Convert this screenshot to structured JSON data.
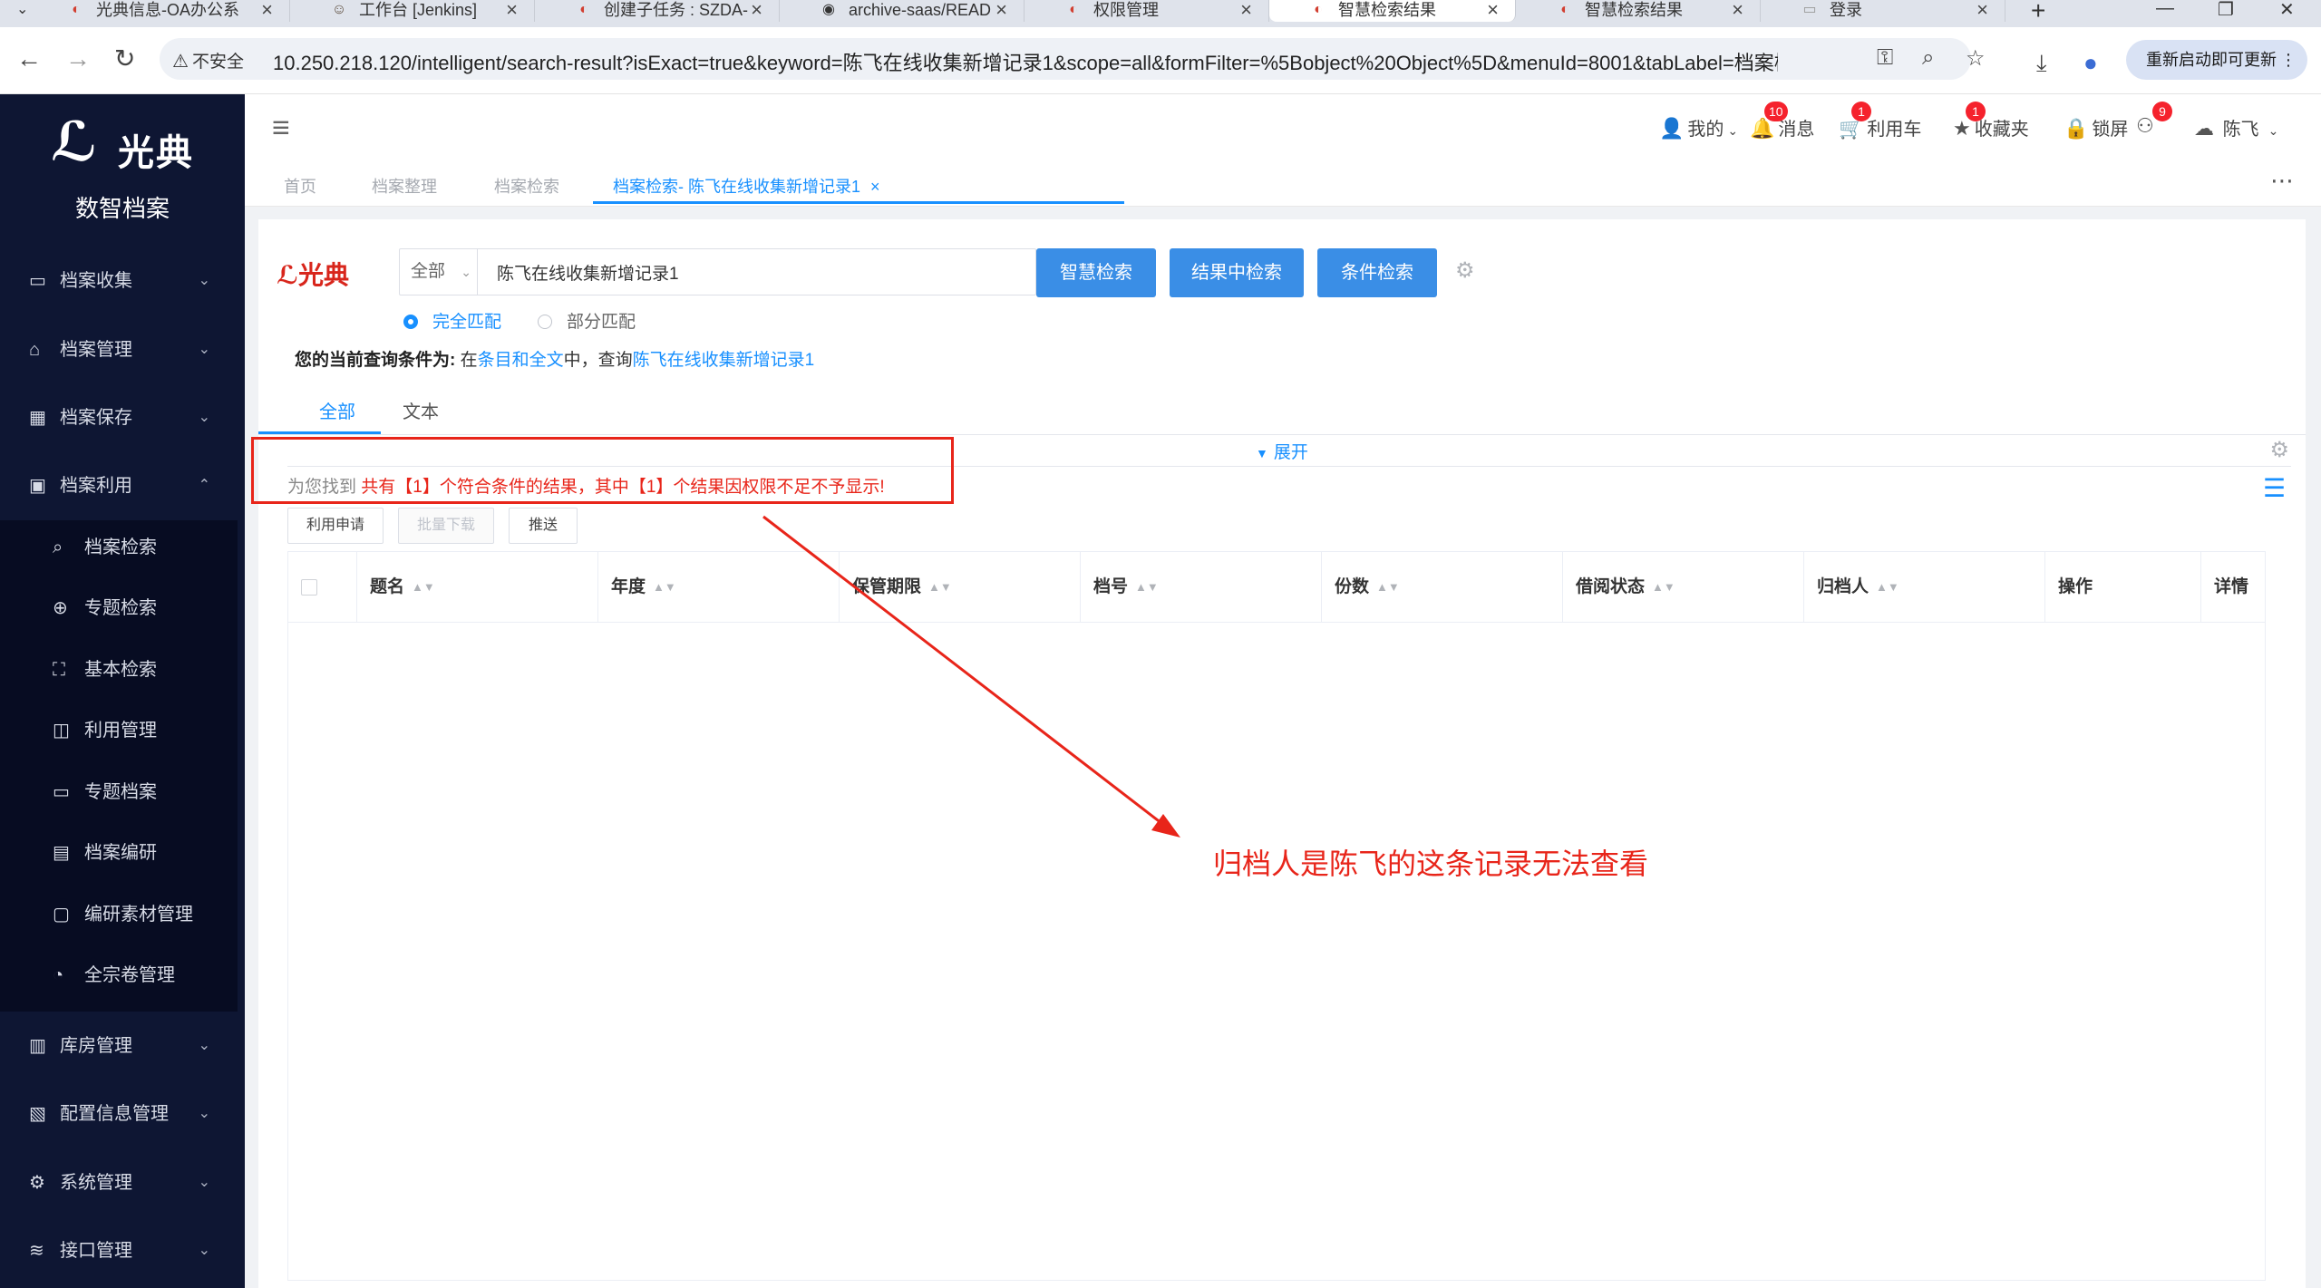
{
  "browser": {
    "tabs": [
      {
        "title": "光典信息-OA办公系",
        "icon": "document-icon"
      },
      {
        "title": "工作台 [Jenkins]",
        "icon": "jenkins-icon"
      },
      {
        "title": "创建子任务 : SZDA-",
        "icon": "task-icon"
      },
      {
        "title": "archive-saas/READ",
        "icon": "globe-icon"
      },
      {
        "title": "权限管理",
        "icon": "app-icon"
      },
      {
        "title": "智慧检索结果",
        "icon": "app-icon"
      },
      {
        "title": "智慧检索结果",
        "icon": "app-icon"
      },
      {
        "title": "登录",
        "icon": "login-icon"
      }
    ],
    "security_label": "不安全",
    "url": "10.250.218.120/intelligent/search-result?isExact=true&keyword=陈飞在线收集新增记录1&scope=all&formFilter=%5Bobject%20Object%5D&menuId=8001&tabLabel=档案检...",
    "restart_label": "重新启动即可更新"
  },
  "sidebar": {
    "logo_text": "光典",
    "subtitle": "数智档案",
    "menu_top": [
      {
        "label": "档案收集",
        "icon": "folder-icon"
      },
      {
        "label": "档案管理",
        "icon": "bank-icon"
      },
      {
        "label": "档案保存",
        "icon": "building-icon"
      },
      {
        "label": "档案利用",
        "icon": "clipboard-icon"
      }
    ],
    "submenu": [
      {
        "label": "档案检索",
        "icon": "search-icon"
      },
      {
        "label": "专题检索",
        "icon": "compass-icon"
      },
      {
        "label": "基本检索",
        "icon": "scan-icon"
      },
      {
        "label": "利用管理",
        "icon": "book-icon"
      },
      {
        "label": "专题档案",
        "icon": "folder-open-icon"
      },
      {
        "label": "档案编研",
        "icon": "document-icon"
      },
      {
        "label": "编研素材管理",
        "icon": "save-icon"
      },
      {
        "label": "全宗卷管理",
        "icon": "dashboard-icon"
      }
    ],
    "menu_bottom": [
      {
        "label": "库房管理",
        "icon": "warehouse-icon"
      },
      {
        "label": "配置信息管理",
        "icon": "config-icon"
      },
      {
        "label": "系统管理",
        "icon": "gear-icon"
      },
      {
        "label": "接口管理",
        "icon": "database-icon"
      }
    ]
  },
  "header": {
    "my_label": "我的",
    "messages_label": "消息",
    "messages_count": "10",
    "cart_label": "利用车",
    "cart_count": "1",
    "favorites_label": "收藏夹",
    "favorites_count": "1",
    "lock_label": "锁屏",
    "user_badge": "9",
    "username": "陈飞"
  },
  "tags": [
    "首页",
    "档案整理",
    "档案检索",
    "档案检索- 陈飞在线收集新增记录1"
  ],
  "search": {
    "brand": "光典",
    "scope": "全部",
    "keyword": "陈飞在线收集新增记录1",
    "btn_smart": "智慧检索",
    "btn_in_results": "结果中检索",
    "btn_condition": "条件检索",
    "match_exact": "完全匹配",
    "match_partial": "部分匹配",
    "condition_label": "您的当前查询条件为:",
    "condition_pre": "在",
    "condition_scope": "条目和全文",
    "condition_mid": "中，查询",
    "condition_keyword": "陈飞在线收集新增记录1"
  },
  "result_tabs": [
    "全部",
    "文本"
  ],
  "expand_label": "展开",
  "result_msg": {
    "prefix": "为您找到",
    "highlight": "共有【1】个符合条件的结果，其中【1】个结果因权限不足不予显示!"
  },
  "actions": [
    "利用申请",
    "批量下载",
    "推送"
  ],
  "table": {
    "columns": [
      "题名",
      "年度",
      "保管期限",
      "档号",
      "份数",
      "借阅状态",
      "归档人",
      "操作",
      "详情"
    ],
    "rows": []
  },
  "annotation": {
    "text": "归档人是陈飞的这条记录无法查看",
    "color": "#e8251a"
  },
  "colors": {
    "primary": "#3a8ee6",
    "link": "#1890ff",
    "sidebar_bg": "#0e1633",
    "alert_red": "#e8251a"
  }
}
